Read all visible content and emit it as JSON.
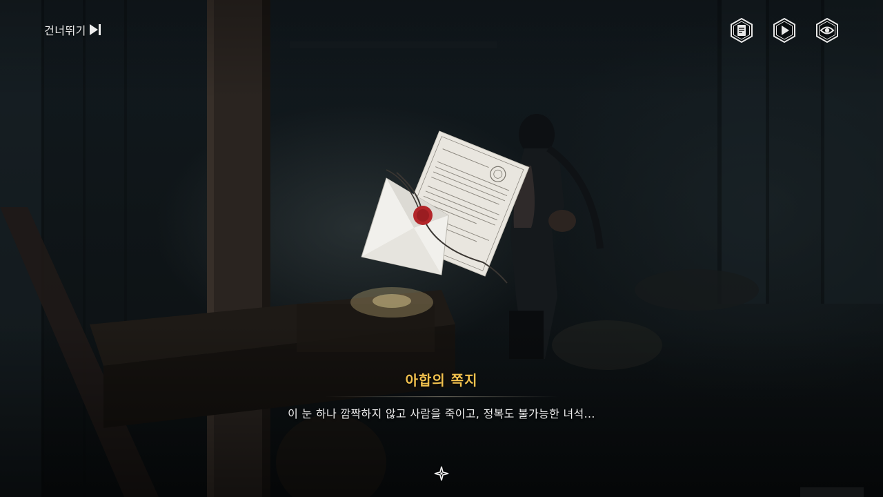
{
  "skip": {
    "label": "건너뛰기",
    "icon": "skip-forward-icon"
  },
  "top_right_buttons": [
    {
      "name": "log-button",
      "icon": "document-log-icon"
    },
    {
      "name": "auto-play-button",
      "icon": "play-icon"
    },
    {
      "name": "hide-ui-button",
      "icon": "eye-icon"
    }
  ],
  "dialogue": {
    "speaker": "아합의 쪽지",
    "text": "이 눈 하나 깜짝하지 않고 사람을 죽이고, 정복도 불가능한 녀석…",
    "next_icon": "sparkle-next-icon"
  },
  "colors": {
    "speaker": "#f2c14e",
    "text": "#f1f1f1",
    "hud_icon": "#e8e8e8",
    "wax_seal": "#b3262a"
  }
}
